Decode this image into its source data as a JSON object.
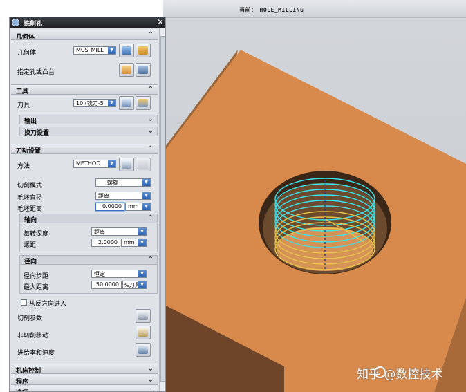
{
  "viewport": {
    "current_label": "当前：",
    "current_value": "HOLE_MILLING"
  },
  "watermark": {
    "text": "知乎 @数控技术"
  },
  "dialog": {
    "title": "铣削孔",
    "close": "✕",
    "sections": {
      "geometry": {
        "label": "几何体",
        "geometry_label": "几何体",
        "geometry_value": "MCS_MILL",
        "specify_label": "指定孔或凸台"
      },
      "tool": {
        "label": "工具",
        "tool_label": "刀具",
        "tool_value": "10 (铣刀-5",
        "output_label": "输出",
        "change_label": "换刀设置"
      },
      "path": {
        "label": "刀轨设置",
        "method_label": "方法",
        "method_value": "METHOD",
        "cut_mode_label": "切削模式",
        "cut_mode_value": "螺旋",
        "blank_diameter_label": "毛坯直径",
        "blank_diameter_value": "距离",
        "blank_distance_label": "毛坯距离",
        "blank_distance_value": "0.0000",
        "blank_distance_unit": "mm",
        "axial": {
          "label": "轴向",
          "depth_per_rev_label": "每转深度",
          "depth_per_rev_value": "距离",
          "pitch_label": "螺距",
          "pitch_value": "2.0000",
          "pitch_unit": "mm"
        },
        "radial": {
          "label": "径向",
          "step_label": "径向步距",
          "step_value": "恒定",
          "max_distance_label": "最大距离",
          "max_distance_value": "50.0000",
          "max_distance_unit": "%刀具"
        },
        "reverse_label": "从反方向进入",
        "cut_params_label": "切削参数",
        "noncut_label": "非切削移动",
        "feeds_label": "进给率和速度"
      },
      "machine_label": "机床控制",
      "program_label": "程序",
      "options_label": "选项"
    }
  },
  "colors": {
    "block": "#d4874a",
    "block_dark": "#8a5a33",
    "toolpath_cyan": "#35e6f0",
    "toolpath_yellow": "#e8c24a",
    "title_bar": "#25282d"
  }
}
